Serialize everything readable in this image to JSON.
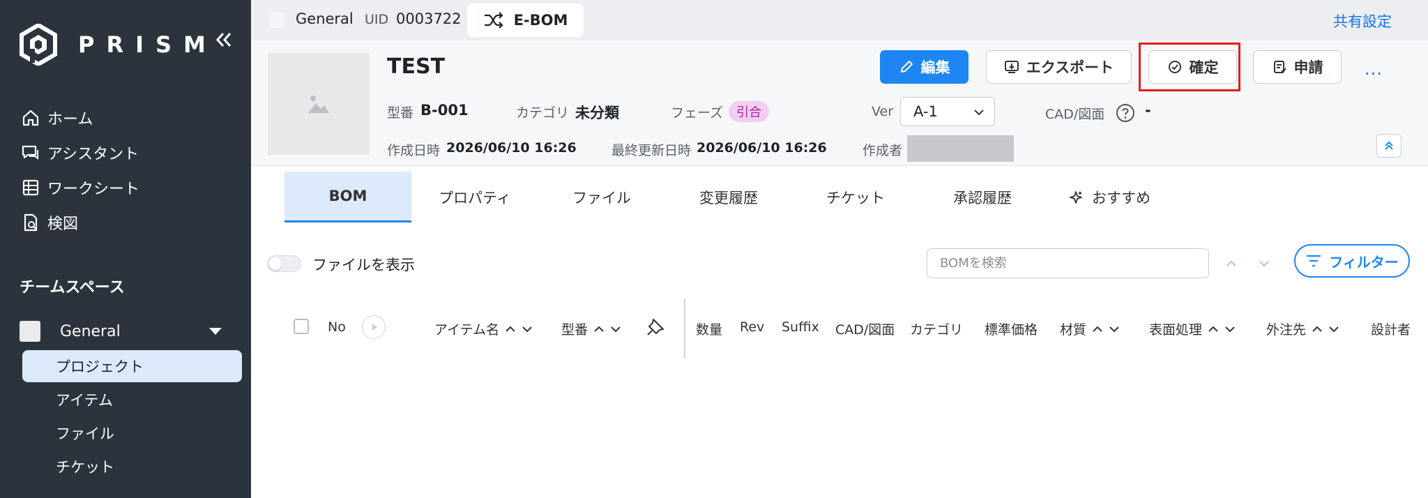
{
  "sidebar": {
    "brand": "PRISM",
    "nav": [
      {
        "label": "ホーム",
        "icon": "home-icon"
      },
      {
        "label": "アシスタント",
        "icon": "chat-icon"
      },
      {
        "label": "ワークシート",
        "icon": "table-icon"
      },
      {
        "label": "検図",
        "icon": "document-check-icon"
      }
    ],
    "team_heading": "チームスペース",
    "workspace": "General",
    "sub_items": [
      {
        "label": "プロジェクト",
        "active": true
      },
      {
        "label": "アイテム"
      },
      {
        "label": "ファイル"
      },
      {
        "label": "チケット"
      }
    ]
  },
  "topbar": {
    "workspace": "General",
    "uid_label": "UID",
    "uid_value": "0003722",
    "pill_label": "E-BOM",
    "share": "共有設定"
  },
  "header": {
    "title": "TEST",
    "buttons": {
      "edit": "編集",
      "export": "エクスポート",
      "confirm": "確定",
      "apply": "申請",
      "more": "···"
    },
    "fields": {
      "model_label": "型番",
      "model_value": "B-001",
      "category_label": "カテゴリ",
      "category_value": "未分類",
      "phase_label": "フェーズ",
      "phase_value": "引合",
      "ver_label": "Ver",
      "ver_value": "A-1",
      "cad_label": "CAD/図面",
      "cad_value": "-",
      "created_label": "作成日時",
      "created_value": "2026/06/10 16:26",
      "updated_label": "最終更新日時",
      "updated_value": "2026/06/10 16:26",
      "creator_label": "作成者"
    }
  },
  "tabs": [
    "BOM",
    "プロパティ",
    "ファイル",
    "変更履歴",
    "チケット",
    "承認履歴",
    "おすすめ"
  ],
  "toolbar": {
    "toggle_label": "ファイルを表示",
    "search_placeholder": "BOMを検索",
    "filter": "フィルター"
  },
  "columns": [
    "No",
    "アイテム名",
    "型番",
    "数量",
    "Rev",
    "Suffix",
    "CAD/図面",
    "カテゴリ",
    "標準価格",
    "材質",
    "表面処理",
    "外注先",
    "設計者"
  ],
  "colors": {
    "accent": "#1d86f2",
    "sidebar": "#2b333d",
    "highlight": "#e51b1b"
  }
}
